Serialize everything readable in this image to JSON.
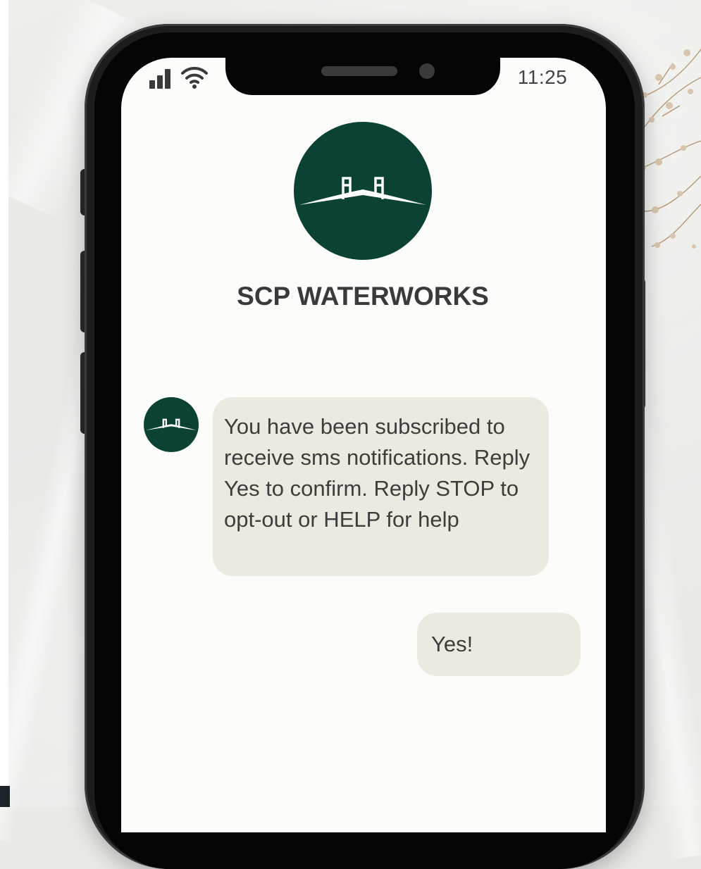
{
  "status_bar": {
    "time": "11:25",
    "signal_icon": "cellular-signal-icon",
    "wifi_icon": "wifi-icon"
  },
  "contact": {
    "name": "SCP WATERWORKS",
    "avatar_icon": "bridge-logo-icon",
    "avatar_color": "#0b4233"
  },
  "messages": [
    {
      "direction": "incoming",
      "text": "You have been subscribed to receive sms notifications. Reply Yes to confirm. Reply STOP to opt-out or HELP for help"
    },
    {
      "direction": "outgoing",
      "text": "Yes!"
    }
  ],
  "colors": {
    "bubble": "#ece9e0",
    "screen": "#fcfcfb",
    "brand": "#0b4233"
  }
}
